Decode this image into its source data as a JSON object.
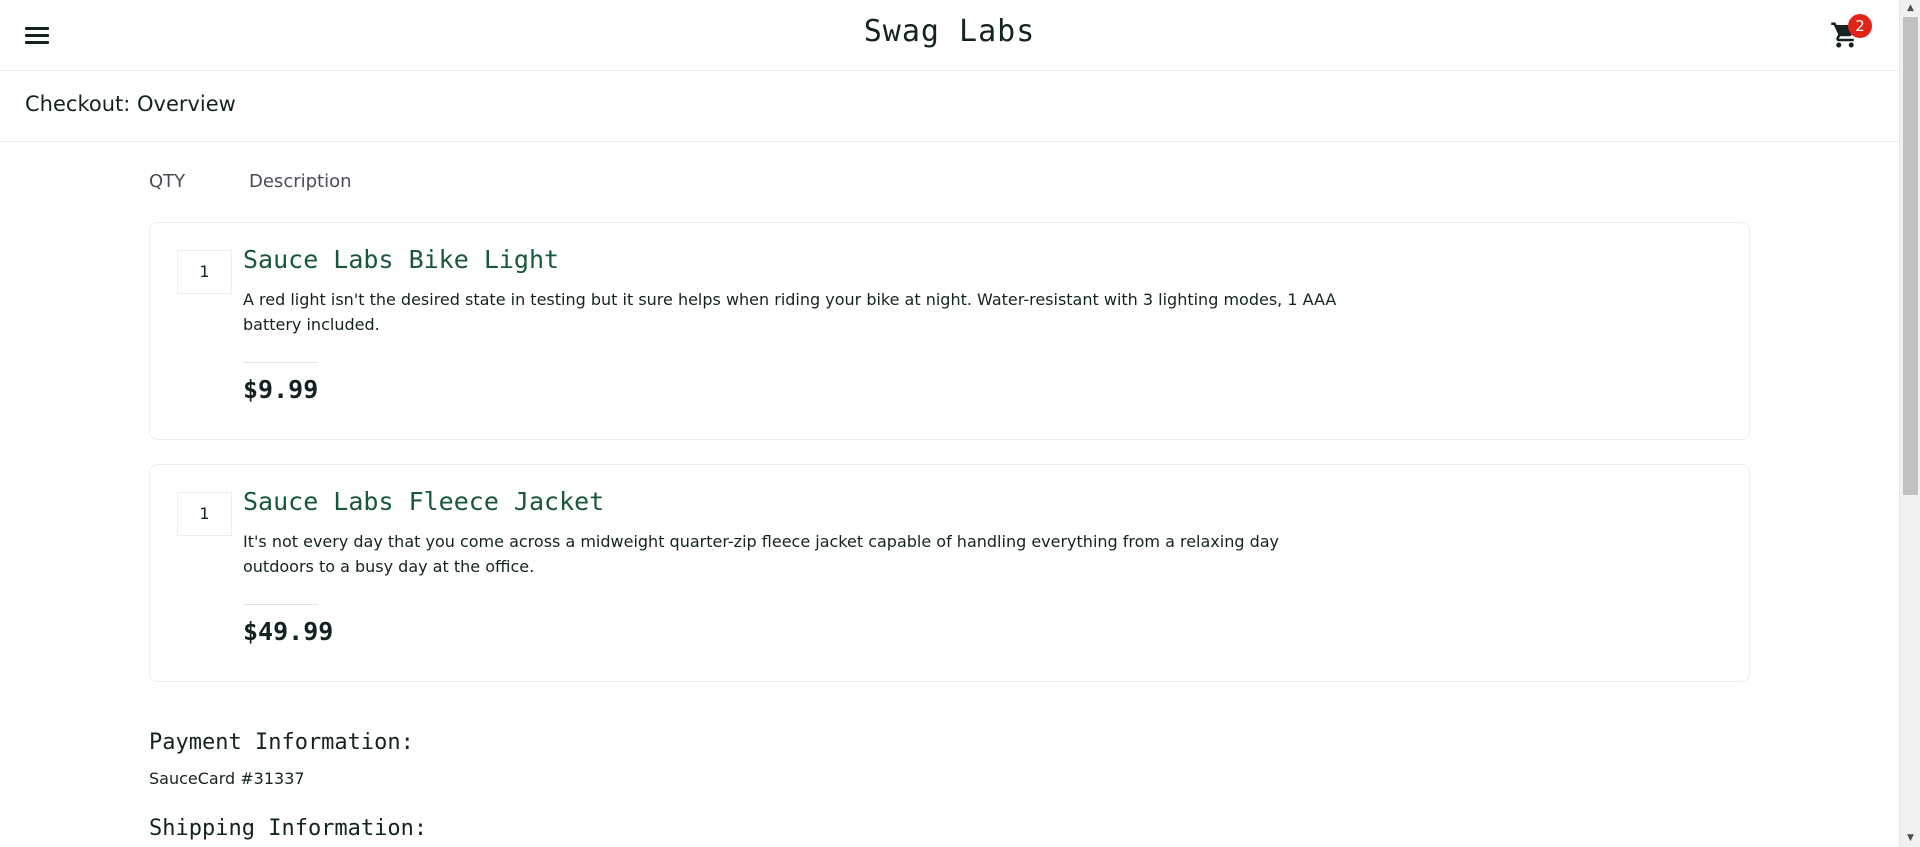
{
  "header": {
    "logo": "Swag Labs",
    "cart_badge": "2"
  },
  "secondary_header": {
    "title": "Checkout: Overview"
  },
  "cart_list": {
    "qty_label": "QTY",
    "desc_label": "Description",
    "items": [
      {
        "quantity": "1",
        "name": "Sauce Labs Bike Light",
        "description": "A red light isn't the desired state in testing but it sure helps when riding your bike at night. Water-resistant with 3 lighting modes, 1 AAA battery included.",
        "price": "$9.99"
      },
      {
        "quantity": "1",
        "name": "Sauce Labs Fleece Jacket",
        "description": "It's not every day that you come across a midweight quarter-zip fleece jacket capable of handling everything from a relaxing day outdoors to a busy day at the office.",
        "price": "$49.99"
      }
    ]
  },
  "summary": {
    "payment_label": "Payment Information:",
    "payment_value": "SauceCard #31337",
    "shipping_label": "Shipping Information:"
  },
  "colors": {
    "accent_green": "#18583a",
    "badge_red": "#e2231a",
    "text_dark": "#132322",
    "border": "#ededed"
  },
  "icons": {
    "menu": "hamburger-menu-icon",
    "cart": "shopping-cart-icon",
    "scroll_up": "triangle-up-icon",
    "scroll_down": "triangle-down-icon"
  }
}
